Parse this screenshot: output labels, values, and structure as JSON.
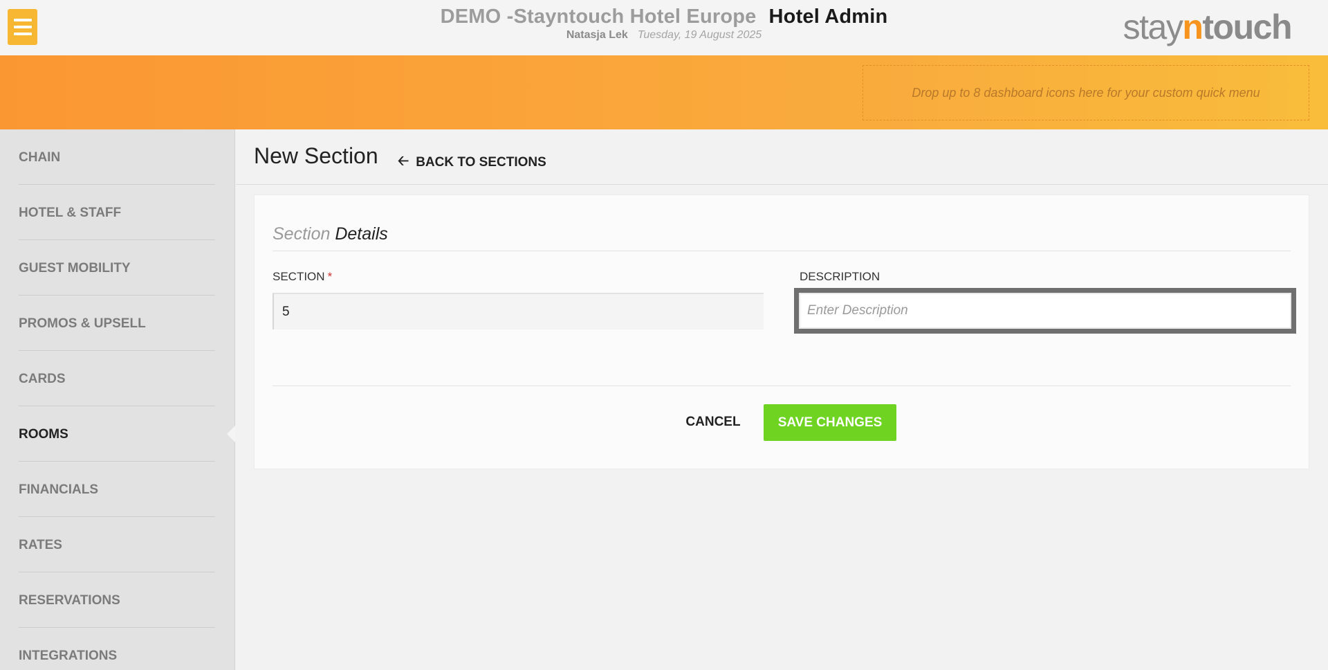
{
  "header": {
    "hotel_name": "DEMO -Stayntouch Hotel Europe",
    "app_name": "Hotel Admin",
    "user_name": "Natasja Lek",
    "date": "Tuesday, 19 August 2025",
    "logo": {
      "part1": "stay",
      "part2": "n",
      "part3": "touch"
    }
  },
  "quick_menu": {
    "drop_text": "Drop up to 8 dashboard icons here for your custom quick menu"
  },
  "sidebar": {
    "items": [
      {
        "label": "CHAIN",
        "active": false
      },
      {
        "label": "HOTEL & STAFF",
        "active": false
      },
      {
        "label": "GUEST MOBILITY",
        "active": false
      },
      {
        "label": "PROMOS & UPSELL",
        "active": false
      },
      {
        "label": "CARDS",
        "active": false
      },
      {
        "label": "ROOMS",
        "active": true
      },
      {
        "label": "FINANCIALS",
        "active": false
      },
      {
        "label": "RATES",
        "active": false
      },
      {
        "label": "RESERVATIONS",
        "active": false
      },
      {
        "label": "INTEGRATIONS",
        "active": false
      }
    ]
  },
  "page": {
    "title": "New Section",
    "back_label": "BACK TO SECTIONS"
  },
  "form": {
    "title_light": "Section",
    "title_dark": "Details",
    "section_label": "SECTION",
    "required_mark": "*",
    "section_value": "5",
    "description_label": "DESCRIPTION",
    "description_value": "",
    "description_placeholder": "Enter Description",
    "cancel_label": "CANCEL",
    "save_label": "SAVE CHANGES"
  },
  "colors": {
    "accent_orange": "#fb9733",
    "menu_button": "#f7b733",
    "save_green": "#6ed321"
  }
}
